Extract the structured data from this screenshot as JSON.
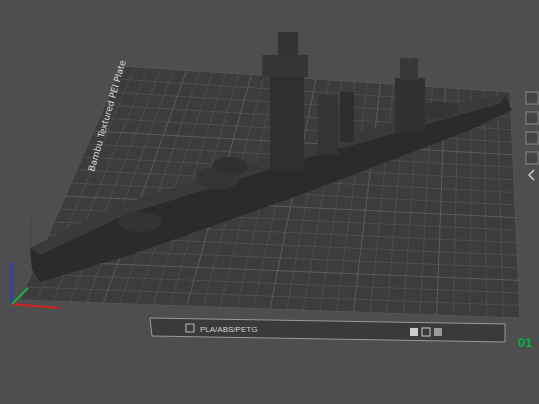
{
  "plate": {
    "label": "Bambu Textured PEI Plate",
    "number": "01"
  },
  "filament_bar": {
    "label": "PLA/ABS/PETG"
  }
}
